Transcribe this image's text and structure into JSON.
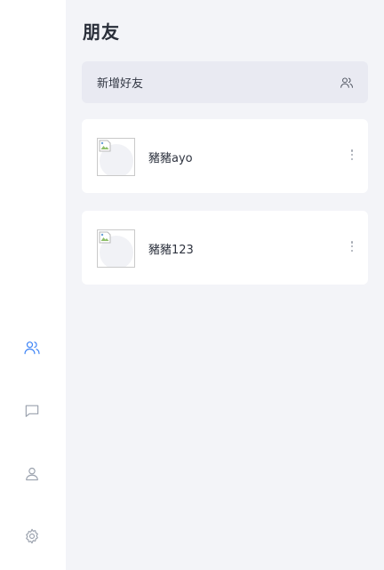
{
  "page": {
    "title": "朋友"
  },
  "add_friend": {
    "label": "新增好友",
    "icon": "add-user-icon"
  },
  "friends": [
    {
      "name": "豬豬ayo"
    },
    {
      "name": "豬豬123"
    }
  ],
  "sidebar": {
    "items": [
      {
        "id": "friends",
        "icon": "users-icon",
        "active": true
      },
      {
        "id": "chat",
        "icon": "message-square-icon",
        "active": false
      },
      {
        "id": "profile",
        "icon": "user-icon",
        "active": false
      },
      {
        "id": "settings",
        "icon": "settings-gear-icon",
        "active": false
      }
    ]
  },
  "colors": {
    "accent": "#3b82f6",
    "background": "#f3f4f8",
    "card": "#ffffff",
    "add_bar": "#e9eaf2",
    "icon_inactive": "#9aa1ad"
  }
}
